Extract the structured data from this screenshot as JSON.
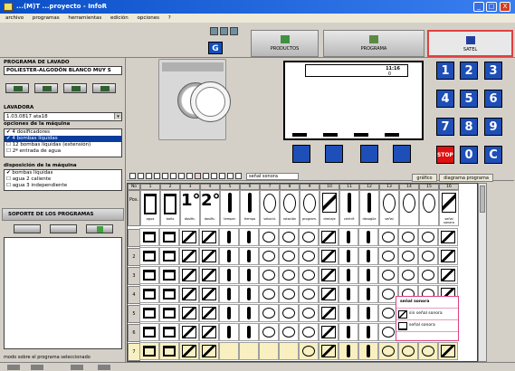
{
  "window": {
    "title": "...(M)T ...proyecto - InfoR",
    "min": "_",
    "max": "□",
    "close": "X"
  },
  "menu": [
    "archivo",
    "programas",
    "herramientas",
    "edición",
    "opciones",
    "?"
  ],
  "tabs": [
    {
      "label": "PRODUCTOS",
      "icon": "products-icon"
    },
    {
      "label": "PROGRAMA",
      "icon": "program-icon"
    },
    {
      "label": "SATEL",
      "icon": "satel-icon",
      "active": true
    }
  ],
  "g_button": "G",
  "left": {
    "prog_heading": "PROGRAMA DE LAVADO",
    "prog_name": "POLIESTER-ALGODÓN BLANCO MUY S",
    "lavadora_heading": "LAVADORA",
    "lavadora_value": "1.03.0817 ata18",
    "opciones_heading": "opciones de la máquina",
    "opciones": [
      "4 dosificadores",
      "4 bombas líquidas",
      "12 bombas líquidas (extensión)",
      "2ª entrada de agua"
    ],
    "disposicion_heading": "disposición de la máquina",
    "disposicion": [
      "bombas líquidas",
      "agua 2 caliente",
      "agua 3 independiente"
    ],
    "soporte_heading": "SOPORTE DE LOS PROGRAMAS",
    "footer_label": "modo sobre el programa seleccionado"
  },
  "display": {
    "time": "11:16",
    "sub": "0"
  },
  "keypad": [
    {
      "label": "1",
      "sub": ""
    },
    {
      "label": "2",
      "sub": ""
    },
    {
      "label": "3",
      "sub": ""
    },
    {
      "label": "4",
      "sub": "◂"
    },
    {
      "label": "5",
      "sub": ""
    },
    {
      "label": "6",
      "sub": "▸"
    },
    {
      "label": "7",
      "sub": ""
    },
    {
      "label": "8",
      "sub": ""
    },
    {
      "label": "9",
      "sub": ""
    },
    {
      "label": "STOP",
      "sub": ""
    },
    {
      "label": "0",
      "sub": ""
    },
    {
      "label": "C",
      "sub": ""
    }
  ],
  "grid_toolbar": {
    "field": "señal sonora",
    "tab1": "gráfico",
    "tab2": "diagrama programa"
  },
  "grid": {
    "headers": [
      "No",
      "1",
      "2",
      "3",
      "4",
      "5",
      "6",
      "7",
      "8",
      "9",
      "10",
      "11",
      "12",
      "13",
      "14",
      "15",
      "16"
    ],
    "first_col": [
      "Pos.",
      "",
      "2",
      "3",
      "4",
      "5",
      "6",
      "7",
      "8"
    ],
    "row_labels": [
      "agua",
      "baño",
      "dosific.",
      "dosific.",
      "temper.",
      "tiempo",
      "velocid.",
      "rotación",
      "program.",
      "drenaje",
      "centrif.",
      "desagüe",
      "señal",
      "señal sonora"
    ]
  },
  "popup": {
    "title": "señal sonora",
    "items": [
      "sin señal sonora",
      "señal sonora"
    ]
  },
  "footer": {
    "icons": [
      "nav-first-icon",
      "nav-prev-icon",
      "nav-next-icon",
      "nav-last-icon"
    ]
  }
}
